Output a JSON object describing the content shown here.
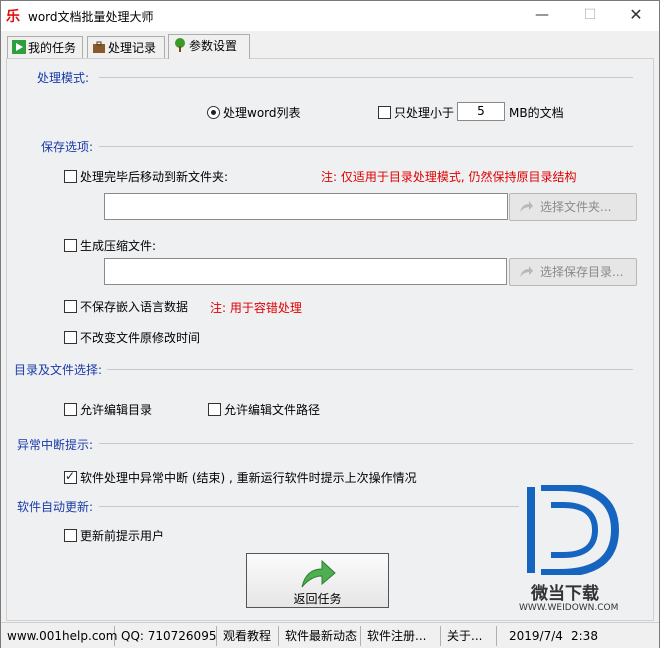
{
  "window": {
    "title": "word文档批量处理大师",
    "app_icon_glyph": "乐"
  },
  "tabs": [
    {
      "label": "我的任务",
      "icon": "play-icon"
    },
    {
      "label": "处理记录",
      "icon": "briefcase-icon"
    },
    {
      "label": "参数设置",
      "icon": "tree-icon",
      "active": true
    }
  ],
  "process_mode": {
    "label": "处理模式:",
    "radio_word_list": "处理word列表",
    "only_small_prefix": "只处理小于",
    "size_value": "5",
    "size_suffix": "MB的文档"
  },
  "save_options": {
    "label": "保存选项:",
    "move_folder_label": "处理完毕后移动到新文件夹:",
    "move_folder_note": "注: 仅适用于目录处理模式, 仍然保持原目录结构",
    "choose_folder_button": "选择文件夹...",
    "zip_label": "生成压缩文件:",
    "choose_save_dir_button": "选择保存目录...",
    "no_embed_lang_label": "不保存嵌入语言数据",
    "no_embed_lang_note": "注: 用于容错处理",
    "keep_mtime_label": "不改变文件原修改时间"
  },
  "dir_file": {
    "label": "目录及文件选择:",
    "allow_edit_dir": "允许编辑目录",
    "allow_edit_path": "允许编辑文件路径"
  },
  "abnormal": {
    "label": "异常中断提示:",
    "prompt_label": "软件处理中异常中断 (结束) , 重新运行软件时提示上次操作情况",
    "prompt_checked": true
  },
  "auto_update": {
    "label": "软件自动更新:",
    "prompt_user_label": "更新前提示用户"
  },
  "return_button": {
    "label": "返回任务"
  },
  "watermark": {
    "brand": "微当下载",
    "url": "WWW.WEIDOWN.COM"
  },
  "statusbar": {
    "website": "www.001help.com",
    "qq": "QQ: 710726095",
    "tutorial": "观看教程",
    "news": "软件最新动态",
    "register": "软件注册...",
    "about": "关于...",
    "date": "2019/7/4",
    "time": "2:38"
  },
  "colors": {
    "section_label": "#1a3aa8",
    "note": "#e00000",
    "return_arrow": "#4caf50"
  }
}
